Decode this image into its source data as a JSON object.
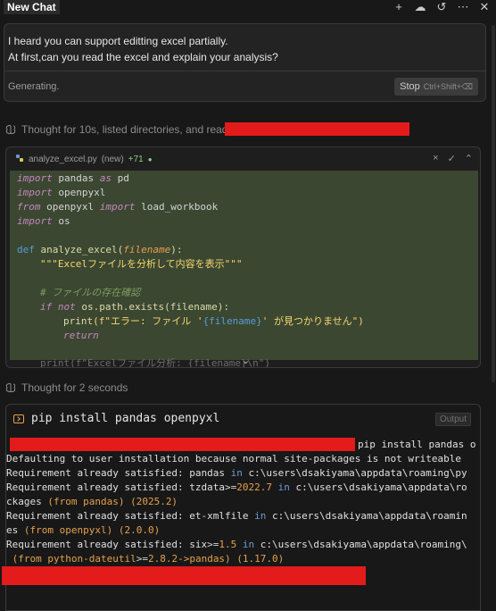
{
  "header": {
    "title": "New Chat",
    "icons": [
      "plus-icon",
      "cloud-icon",
      "history-icon",
      "more-icon",
      "close-icon"
    ],
    "glyphs": {
      "plus": "+",
      "cloud": "☁",
      "history": "↺",
      "more": "⋯",
      "close": "✕"
    }
  },
  "message": {
    "line1": "I heard you can support editting excel partially.",
    "line2": "At first,can you read the excel and explain your analysis?",
    "status": "Generating.",
    "stop_label": "Stop",
    "stop_shortcut": "Ctrl+Shift+⌫"
  },
  "thought1": {
    "text": "Thought for 10s, listed directories, and read"
  },
  "code": {
    "filename": "analyze_excel.py",
    "tag": "(new)",
    "added": "+71",
    "actions": {
      "close": "×",
      "accept": "✓",
      "expand": "⌃"
    },
    "lines": {
      "l1b": "pandas",
      "l1c": "pd",
      "l2b": "openpyxl",
      "l3b": "openpyxl",
      "l3d": "load_workbook",
      "l4b": "os",
      "l6b": "analyze_excel",
      "l6c": "filename",
      "l7": "\"\"\"Excelファイルを分析して内容を表示\"\"\"",
      "l9": "# ファイルの存在確認",
      "l10b": "os.path.exists",
      "l10c": "(filename):",
      "l11a": "print",
      "l11b": "(f\"エラー: ファイル '",
      "l11c": "{filename}",
      "l11d": "' が見つかりません\")",
      "l12": "return",
      "l14": "print(f\"Excelファイル分析: {filename}\\n\")"
    },
    "keywords": {
      "import": "import",
      "as": "as",
      "from": "from",
      "def": "def",
      "if": "if",
      "not": "not"
    }
  },
  "thought2": {
    "text": "Thought for 2 seconds"
  },
  "terminal": {
    "command": "pip install pandas openpyxl",
    "output_label": "Output",
    "prompt_tail": "pip install pandas o",
    "default_msg": "Defaulting to user installation because normal site-packages is not writeable",
    "req1a": "Requirement already satisfied: pandas ",
    "req1b": "in",
    "req1c": " c:\\users\\dsakiyama\\appdata\\roaming\\py",
    "req2a": "Requirement already satisfied: tzdata",
    "req2b": ">=",
    "req2c": "2022.7",
    "req2e": " c:\\users\\dsakiyama\\appdata\\ro",
    "req2f": "ckages ",
    "req2g": "(from pandas)",
    "req2h": "(2025.2)",
    "req3a": "Requirement already satisfied: et-xmlfile ",
    "req3c": " c:\\users\\dsakiyama\\appdata\\roamin",
    "req3d": "es ",
    "req3e": "(from openpyxl)",
    "req3f": "(2.0.0)",
    "req4a": "Requirement already satisfied: six",
    "req4c": "1.5",
    "req4e": " c:\\users\\dsakiyama\\appdata\\roaming\\",
    "req4f": " (from python-dateutil",
    "req4g": "2.8.2",
    "req4h": "->pandas)",
    "req4i": "(1.17.0)"
  },
  "colors": {
    "background": "#181818",
    "code_highlight": "#3b4731",
    "redaction": "#e31b1b",
    "keyword": "#c586c0",
    "function": "#dcdcaa",
    "string": "#ce9178"
  }
}
